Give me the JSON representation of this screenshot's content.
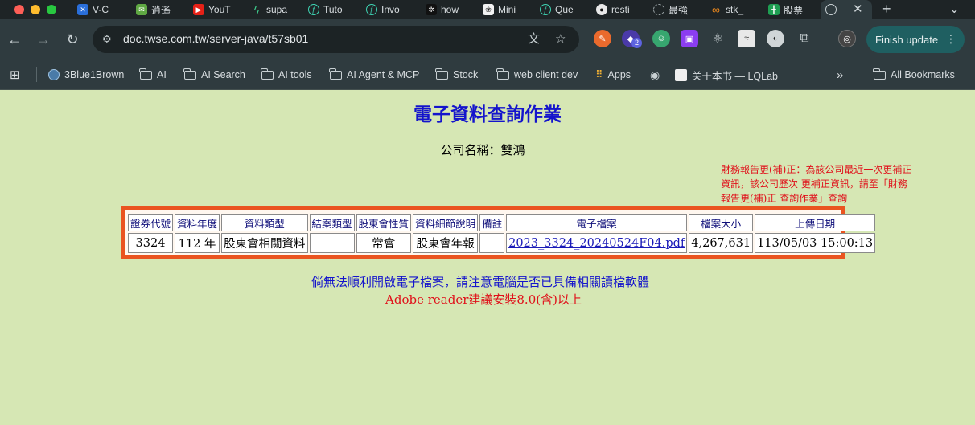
{
  "browser": {
    "tabs": [
      {
        "label": "V-C",
        "icon": "v-logo"
      },
      {
        "label": "逍遙",
        "icon": "mail-icon"
      },
      {
        "label": "YouT",
        "icon": "youtube-icon"
      },
      {
        "label": "supa",
        "icon": "bolt-icon"
      },
      {
        "label": "Tuto",
        "icon": "feather-icon"
      },
      {
        "label": "Invo",
        "icon": "feather-icon"
      },
      {
        "label": "how",
        "icon": "chat-icon"
      },
      {
        "label": "Mini",
        "icon": "openai-icon"
      },
      {
        "label": "Que",
        "icon": "feather-icon"
      },
      {
        "label": "resti",
        "icon": "github-icon"
      },
      {
        "label": "最強",
        "icon": "circle-icon"
      },
      {
        "label": "stk_",
        "icon": "infinity-icon"
      },
      {
        "label": "股票",
        "icon": "sheet-icon"
      },
      {
        "label": "",
        "icon": "globe-icon",
        "active": true
      }
    ],
    "url": "doc.twse.com.tw/server-java/t57sb01",
    "finish_update": "Finish update",
    "ext_badge": "2",
    "bookmarks": [
      {
        "label": "3Blue1Brown",
        "icon": "3b1b-icon"
      },
      {
        "label": "AI",
        "icon": "folder-icon"
      },
      {
        "label": "AI Search",
        "icon": "folder-icon"
      },
      {
        "label": "AI tools",
        "icon": "folder-icon"
      },
      {
        "label": "AI Agent & MCP",
        "icon": "folder-icon"
      },
      {
        "label": "Stock",
        "icon": "folder-icon"
      },
      {
        "label": "web client dev",
        "icon": "folder-icon"
      },
      {
        "label": "Apps",
        "icon": "apps-grid-icon"
      },
      {
        "label": "",
        "icon": "globe-icon"
      },
      {
        "label": "关于本书 — LQLab",
        "icon": "book-icon"
      }
    ],
    "all_bookmarks": "All Bookmarks",
    "overflow": "»"
  },
  "page": {
    "title": "電子資料查詢作業",
    "company": "公司名稱：雙鴻",
    "note": "財務報告更(補)正：為該公司最近一次更補正資訊，該公司歷次 更補正資訊，請至「財務報告更(補)正 查詢作業」查詢",
    "table": {
      "headers": [
        "證券代號",
        "資料年度",
        "資料類型",
        "結案類型",
        "股東會性質",
        "資料細節說明",
        "備註",
        "電子檔案",
        "檔案大小",
        "上傳日期"
      ],
      "row": {
        "code": "3324",
        "year": "112 年",
        "type": "股東會相關資料",
        "close_type": "",
        "meeting": "常會",
        "detail": "股東會年報",
        "remark": "",
        "file": "2023_3324_20240524F04.pdf",
        "size": "4,267,631",
        "uploaded": "113/05/03 15:00:13"
      }
    },
    "footer_line1": "倘無法順利開啟電子檔案，請注意電腦是否已具備相關讀檔軟體",
    "footer_line2": "Adobe reader建議安裝8.0(含)以上"
  },
  "colors": {
    "page_bg": "#d6e7b4",
    "title_blue": "#1414cc",
    "note_red": "#e0101a",
    "table_border": "#ea5420",
    "chrome_dark": "#2f3b3f"
  }
}
